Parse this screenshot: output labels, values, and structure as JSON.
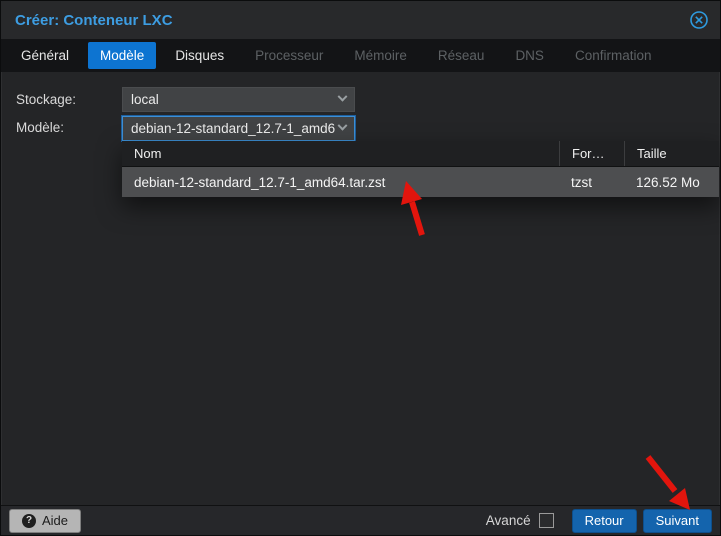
{
  "dialog": {
    "title": "Créer: Conteneur LXC",
    "close_icon": "circle-x-icon"
  },
  "tabs": [
    {
      "label": "Général",
      "state": "enabled"
    },
    {
      "label": "Modèle",
      "state": "active"
    },
    {
      "label": "Disques",
      "state": "enabled"
    },
    {
      "label": "Processeur",
      "state": "disabled"
    },
    {
      "label": "Mémoire",
      "state": "disabled"
    },
    {
      "label": "Réseau",
      "state": "disabled"
    },
    {
      "label": "DNS",
      "state": "disabled"
    },
    {
      "label": "Confirmation",
      "state": "disabled"
    }
  ],
  "form": {
    "storage": {
      "label": "Stockage:",
      "value": "local"
    },
    "template": {
      "label": "Modèle:",
      "value": "debian-12-standard_12.7-1_amd6"
    }
  },
  "dropdown": {
    "columns": [
      "Nom",
      "For…",
      "Taille"
    ],
    "rows": [
      {
        "nom": "debian-12-standard_12.7-1_amd64.tar.zst",
        "format": "tzst",
        "taille": "126.52 Mo"
      }
    ],
    "selected_row_index": 0
  },
  "footer": {
    "help_label": "Aide",
    "help_icon": "?",
    "advanced_label": "Avancé",
    "advanced_checked": false,
    "back_label": "Retour",
    "next_label": "Suivant"
  },
  "colors": {
    "accent_blue": "#0d74d1",
    "button_blue": "#1464ad",
    "title_blue": "#3d9de2",
    "row_highlight": "#4d4e50",
    "annotation_arrow": "#e2150d"
  }
}
